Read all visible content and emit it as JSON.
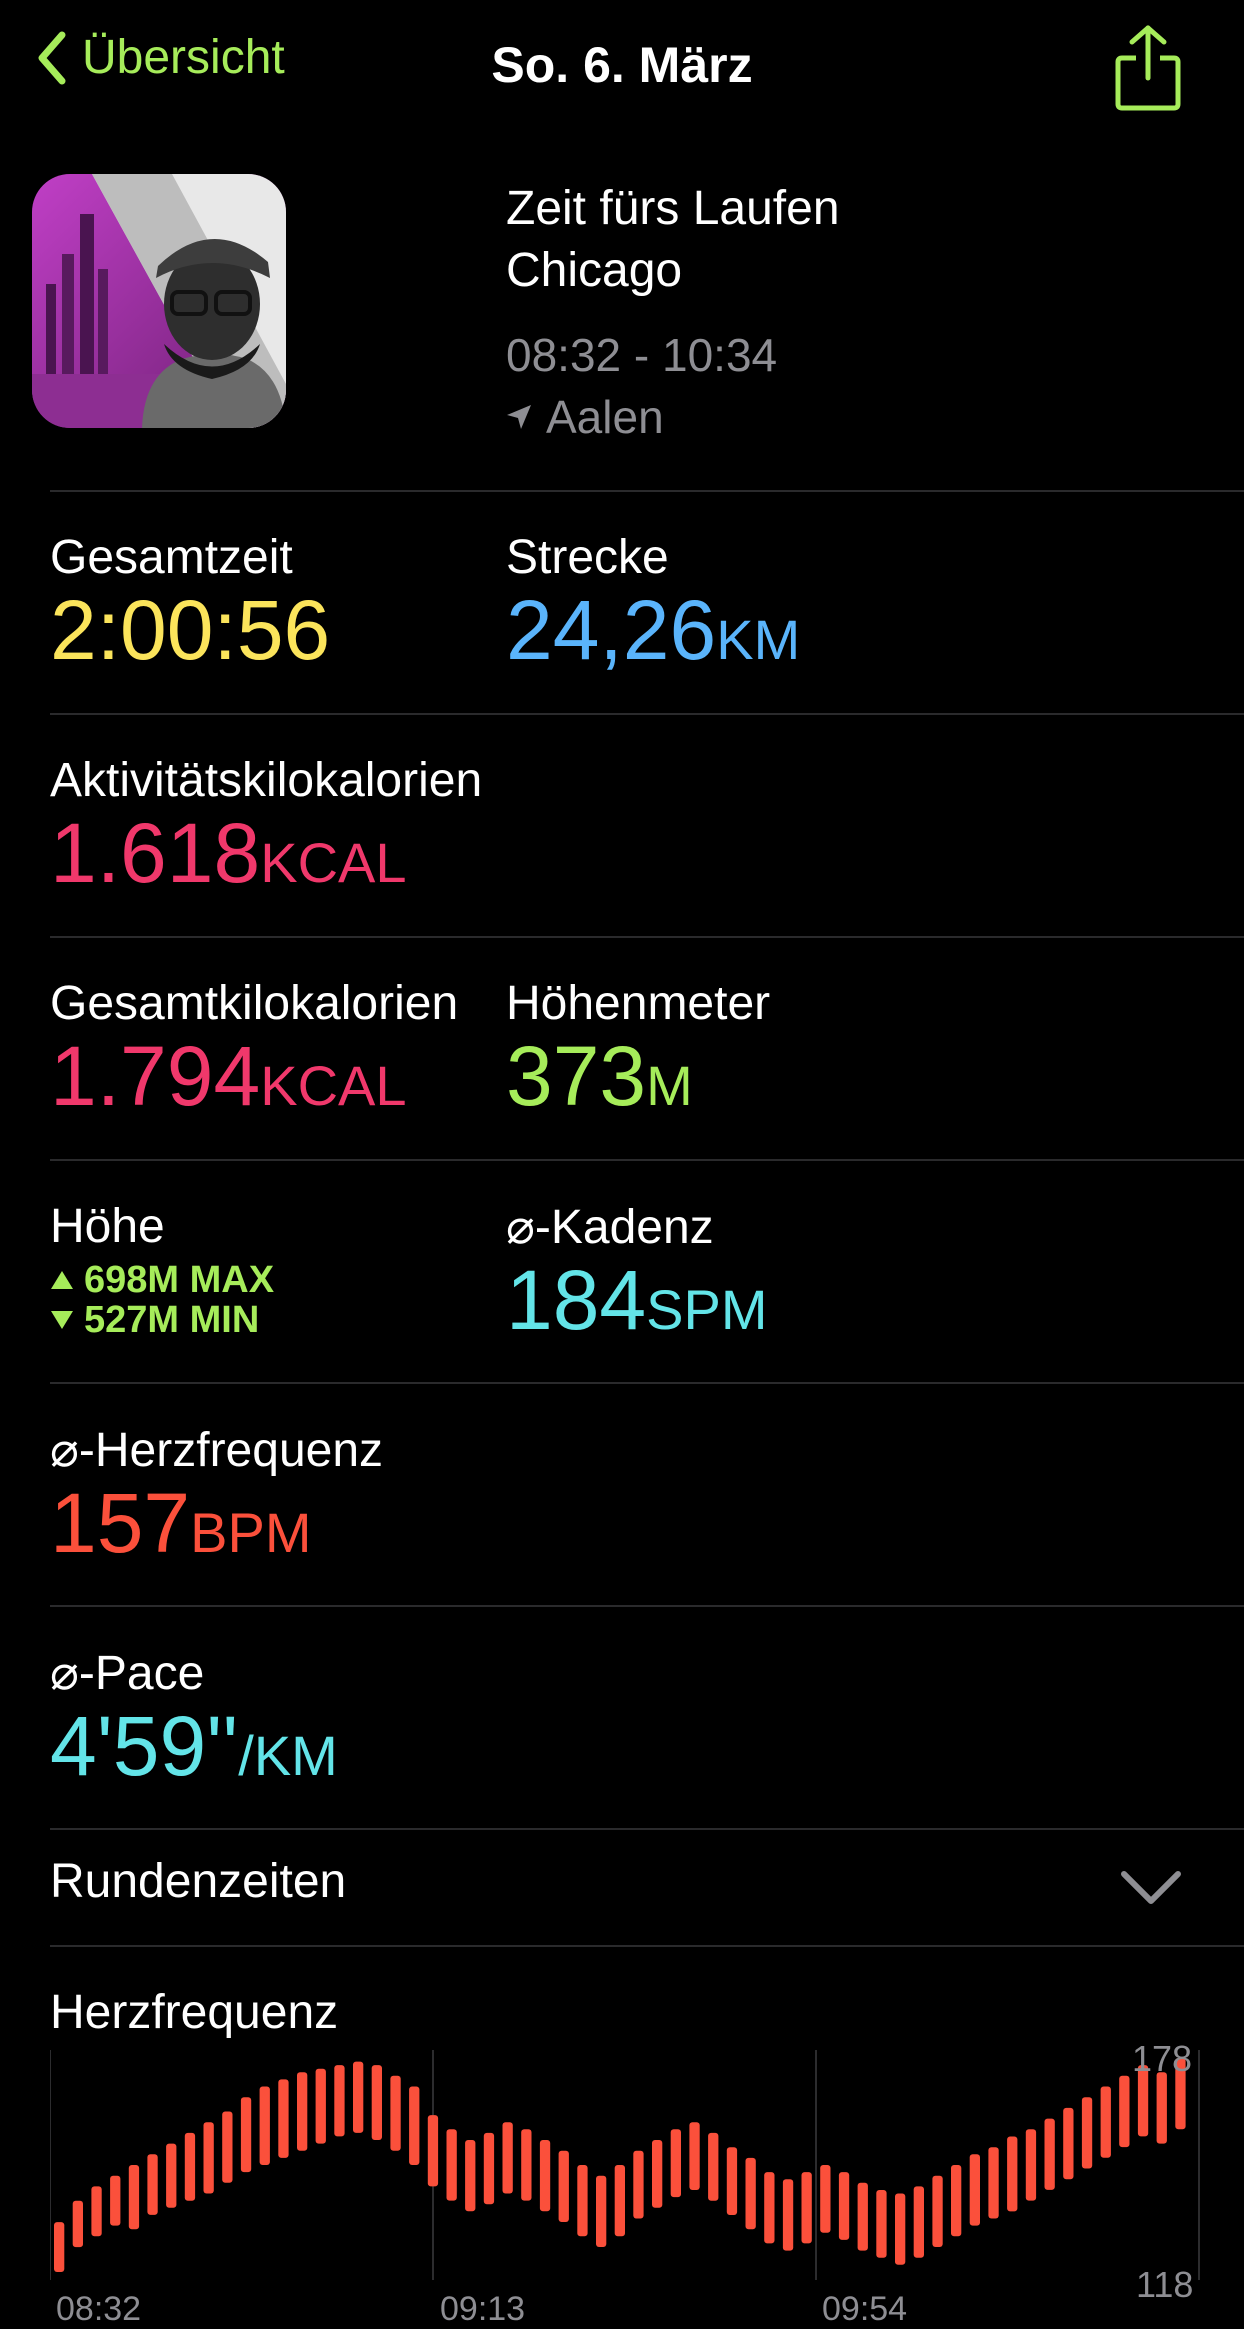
{
  "nav": {
    "back_label": "Übersicht",
    "title": "So. 6. März"
  },
  "workout": {
    "title_line1": "Zeit fürs Laufen",
    "title_line2": "Chicago",
    "time_range": "08:32 - 10:34",
    "location": "Aalen"
  },
  "metrics": {
    "total_time": {
      "label": "Gesamtzeit",
      "value": "2:00:56"
    },
    "distance": {
      "label": "Strecke",
      "value": "24,26",
      "unit": "KM"
    },
    "active_kcal": {
      "label": "Aktivitätskilokalorien",
      "value": "1.618",
      "unit": "KCAL"
    },
    "total_kcal": {
      "label": "Gesamtkilokalorien",
      "value": "1.794",
      "unit": "KCAL"
    },
    "elevation_gain": {
      "label": "Höhenmeter",
      "value": "373",
      "unit": "M"
    },
    "altitude": {
      "label": "Höhe",
      "max": "698M MAX",
      "min": "527M MIN"
    },
    "cadence": {
      "label": "⌀-Kadenz",
      "value": "184",
      "unit": "SPM"
    },
    "heart_rate": {
      "label": "⌀-Herzfrequenz",
      "value": "157",
      "unit": "BPM"
    },
    "pace": {
      "label": "⌀-Pace",
      "value": "4'59''",
      "unit": "/KM"
    }
  },
  "laps": {
    "label": "Rundenzeiten"
  },
  "heart_rate_chart": {
    "title": "Herzfrequenz",
    "y_max_label": "178",
    "y_min_label": "118",
    "x_tick_labels": [
      "08:32",
      "09:13",
      "09:54"
    ]
  },
  "colors": {
    "accent": "#a6ec5a",
    "time": "#fbe45b",
    "distance": "#5ab4fb",
    "kcal": "#f0386b",
    "cadence": "#63e4e8",
    "heart": "#fb503b"
  },
  "chart_data": {
    "type": "bar",
    "title": "Herzfrequenz",
    "ylim": [
      118,
      178
    ],
    "x_ticks": [
      "08:32",
      "09:13",
      "09:54"
    ],
    "grid": true,
    "series": [
      {
        "values": [
          [
            118,
            132
          ],
          [
            125,
            138
          ],
          [
            128,
            142
          ],
          [
            131,
            145
          ],
          [
            130,
            148
          ],
          [
            134,
            151
          ],
          [
            136,
            154
          ],
          [
            138,
            157
          ],
          [
            140,
            160
          ],
          [
            143,
            163
          ],
          [
            146,
            167
          ],
          [
            148,
            170
          ],
          [
            150,
            172
          ],
          [
            152,
            174
          ],
          [
            154,
            175
          ],
          [
            156,
            176
          ],
          [
            157,
            177
          ],
          [
            155,
            176
          ],
          [
            152,
            173
          ],
          [
            148,
            170
          ],
          [
            142,
            162
          ],
          [
            138,
            158
          ],
          [
            135,
            155
          ],
          [
            137,
            157
          ],
          [
            140,
            160
          ],
          [
            138,
            158
          ],
          [
            135,
            155
          ],
          [
            132,
            152
          ],
          [
            128,
            148
          ],
          [
            125,
            145
          ],
          [
            128,
            148
          ],
          [
            133,
            152
          ],
          [
            136,
            155
          ],
          [
            139,
            158
          ],
          [
            141,
            160
          ],
          [
            138,
            157
          ],
          [
            134,
            153
          ],
          [
            130,
            150
          ],
          [
            126,
            146
          ],
          [
            124,
            144
          ],
          [
            126,
            146
          ],
          [
            129,
            148
          ],
          [
            127,
            146
          ],
          [
            124,
            143
          ],
          [
            122,
            141
          ],
          [
            120,
            140
          ],
          [
            122,
            142
          ],
          [
            125,
            145
          ],
          [
            128,
            148
          ],
          [
            131,
            151
          ],
          [
            133,
            153
          ],
          [
            135,
            156
          ],
          [
            138,
            158
          ],
          [
            141,
            161
          ],
          [
            144,
            164
          ],
          [
            147,
            167
          ],
          [
            150,
            170
          ],
          [
            153,
            173
          ],
          [
            156,
            176
          ],
          [
            154,
            174
          ],
          [
            158,
            178
          ]
        ]
      }
    ]
  }
}
